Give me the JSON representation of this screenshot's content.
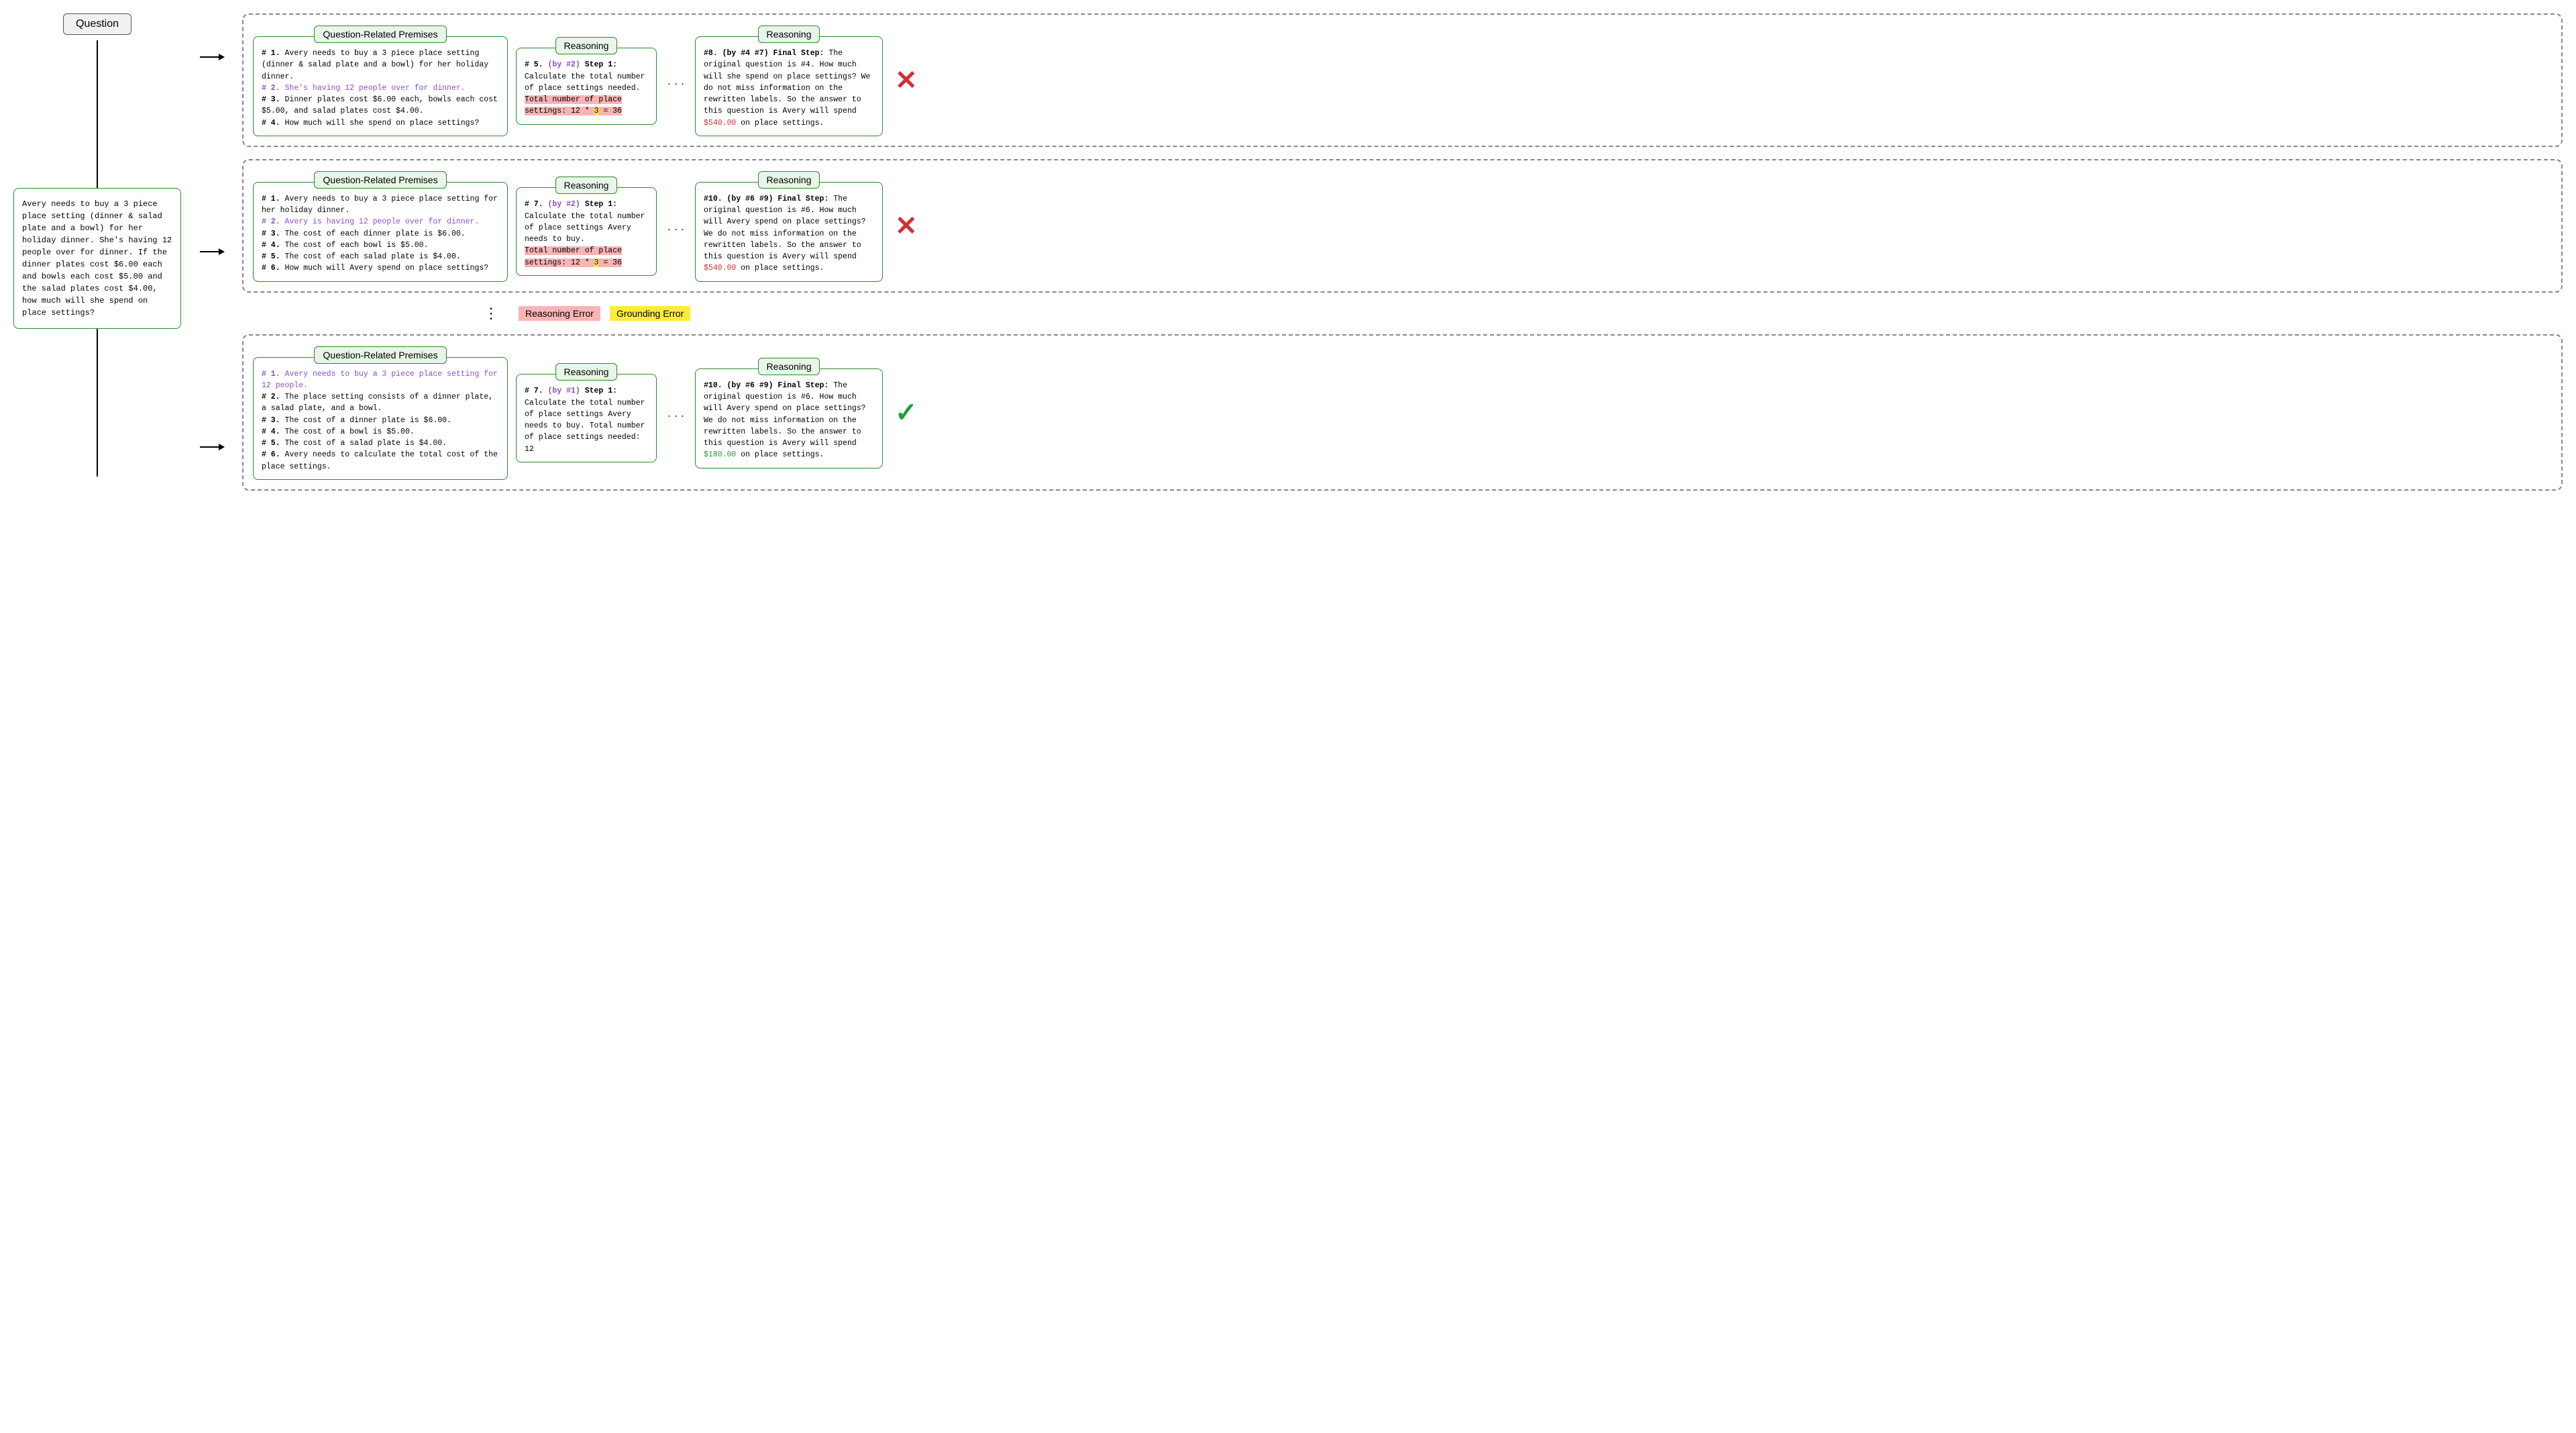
{
  "labels": {
    "question": "Question",
    "premises": "Question-Related Premises",
    "reasoning": "Reasoning"
  },
  "question_text": "Avery needs to buy a 3 piece place setting (dinner & salad plate and a bowl) for her holiday dinner.  She's having 12 people over for dinner.  If the dinner plates cost $6.00 each and bowls each cost $5.00 and the salad plates cost $4.00, how much will she spend on place settings?",
  "legend": {
    "reasoning_error": "Reasoning Error",
    "grounding_error": "Grounding Error"
  },
  "paths": [
    {
      "premises": {
        "lines": [
          {
            "n": "# 1.",
            "txt": " Avery needs to buy a 3 piece place setting (dinner & salad plate and a bowl) for her holiday dinner."
          },
          {
            "n": "# 2.",
            "txt": " She's having 12 people over for dinner.",
            "purple": true
          },
          {
            "n": "# 3.",
            "txt": " Dinner plates cost $6.00 each, bowls each cost $5.00, and salad plates cost $4.00."
          },
          {
            "n": "# 4.",
            "txt": " How much will she spend on place settings?"
          }
        ]
      },
      "r1": {
        "head": "# 5. ",
        "ref": "(by #2)",
        "step": " Step 1:",
        "body_pre": "Calculate the total number of place settings needed.",
        "hl_pink_pre": "Total number of place settings: 12 * ",
        "hl_yellow": "3",
        "hl_pink_post": " = 36"
      },
      "r2": {
        "head": "#8. (by #4 #7) Final Step:",
        "body": " The original question is #4. How much will she spend on place settings? We do not miss information on the rewritten labels. So the answer to this question is Avery will spend ",
        "ans": "$540.00",
        "tail": " on place settings.",
        "ans_class": "red"
      },
      "result": "x"
    },
    {
      "premises": {
        "lines": [
          {
            "n": "# 1.",
            "txt": " Avery needs to buy a 3 piece place setting for her holiday dinner."
          },
          {
            "n": "# 2.",
            "txt": " Avery is having 12 people over for dinner.",
            "purple": true
          },
          {
            "n": "# 3.",
            "txt": " The cost of each dinner plate is $6.00."
          },
          {
            "n": "# 4.",
            "txt": " The cost of each bowl is $5.00."
          },
          {
            "n": "# 5.",
            "txt": " The cost of each salad plate is $4.00."
          },
          {
            "n": "# 6.",
            "txt": " How much will Avery spend on place settings?"
          }
        ]
      },
      "r1": {
        "head": "# 7. ",
        "ref": "(by #2)",
        "step": " Step 1:",
        "body_pre": "Calculate the total number of place settings Avery needs to buy. ",
        "hl_pink_pre": "Total number of place settings: 12 * ",
        "hl_yellow": "3",
        "hl_pink_post": " = 36"
      },
      "r2": {
        "head": "#10. (by #6 #9) Final Step:",
        "body": " The original question is #6. How much will Avery spend on place settings? We do not miss information on the rewritten labels. So the answer to this question is Avery will spend ",
        "ans": "$540.00",
        "tail": " on place settings.",
        "ans_class": "red"
      },
      "result": "x"
    },
    {
      "premises": {
        "lines": [
          {
            "n": "# 1.",
            "txt": " Avery needs to buy a 3 piece place setting for 12 people.",
            "purple": true
          },
          {
            "n": "# 2.",
            "txt": " The place setting consists of a dinner plate, a salad plate, and a bowl."
          },
          {
            "n": "# 3.",
            "txt": " The cost of a dinner plate is $6.00."
          },
          {
            "n": "# 4.",
            "txt": " The cost of a bowl is $5.00."
          },
          {
            "n": "# 5.",
            "txt": " The cost of a salad plate is $4.00."
          },
          {
            "n": "# 6.",
            "txt": " Avery needs to calculate the total cost of the place settings."
          }
        ]
      },
      "r1": {
        "head": "# 7. ",
        "ref": "(by #1)",
        "step": " Step 1:",
        "body_pre": "Calculate the total number of place settings Avery needs to buy. Total number of place settings needed: 12",
        "hl_pink_pre": "",
        "hl_yellow": "",
        "hl_pink_post": ""
      },
      "r2": {
        "head": "#10. (by #6 #9) Final Step:",
        "body": " The original question is #6. How much will Avery spend on place settings? We do not miss information on the rewritten labels. So the answer to this question is Avery will spend ",
        "ans": "$180.00",
        "tail": " on place settings.",
        "ans_class": "green"
      },
      "result": "check"
    }
  ]
}
